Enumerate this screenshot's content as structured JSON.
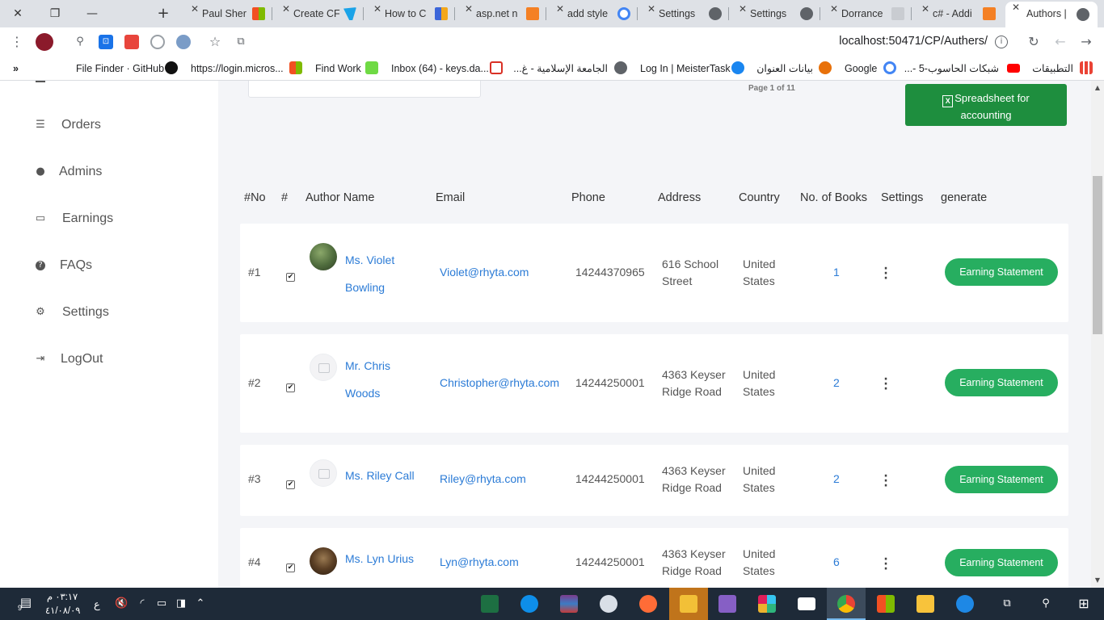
{
  "browser": {
    "tabs": [
      {
        "label": "Paul Sher",
        "favicon_color": "#f25022"
      },
      {
        "label": "Create CF",
        "favicon_color": "#1aa3e8"
      },
      {
        "label": "How to C",
        "favicon_color": "#3c66d9"
      },
      {
        "label": "asp.net n",
        "favicon_color": "#f48024"
      },
      {
        "label": "add style",
        "favicon_color": "#4285f4"
      },
      {
        "label": "Settings",
        "favicon_color": "#5f6368"
      },
      {
        "label": "Settings",
        "favicon_color": "#5f6368"
      },
      {
        "label": "Dorrance",
        "favicon_color": "#c9ccd1"
      },
      {
        "label": "c# - Addi",
        "favicon_color": "#f48024"
      },
      {
        "label": "Authors |",
        "favicon_color": "#5f6368",
        "active": true
      }
    ],
    "url": "localhost:50471/CP/Authers/",
    "bookmarks_left": "»",
    "bookmarks": [
      {
        "label": "File Finder · GitHub",
        "icon": "github-icon",
        "color": "#111"
      },
      {
        "label": "https://login.micros...",
        "icon": "microsoft-icon",
        "color": "#f25022"
      },
      {
        "label": "Find Work",
        "icon": "upwork-icon",
        "color": "#6fda44"
      },
      {
        "label": "Inbox (64) - keys.da...",
        "icon": "gmail-icon",
        "color": "#d93025"
      },
      {
        "label": "الجامعة الإسلامية - غ...",
        "icon": "globe-icon",
        "color": "#5f6368"
      },
      {
        "label": "Log In | MeisterTask",
        "icon": "meistertask-icon",
        "color": "#1a86f0"
      },
      {
        "label": "بيانات العنوان",
        "icon": "orange-site-icon",
        "color": "#e8710a"
      },
      {
        "label": "Google",
        "icon": "google-icon",
        "color": "#4285f4"
      },
      {
        "label": "شبكات الحاسوب-5 -...",
        "icon": "youtube-icon",
        "color": "#ff0000"
      },
      {
        "label": "التطبيقات",
        "icon": "apps-grid-icon",
        "color": "#ea4335"
      }
    ]
  },
  "sidebar": {
    "items": [
      {
        "label": "Orders",
        "icon": "list-icon"
      },
      {
        "label": "Admins",
        "icon": "user-icon"
      },
      {
        "label": "Earnings",
        "icon": "monitor-icon"
      },
      {
        "label": "FAQs",
        "icon": "question-icon"
      },
      {
        "label": "Settings",
        "icon": "cogs-icon"
      },
      {
        "label": "LogOut",
        "icon": "logout-icon"
      }
    ]
  },
  "main": {
    "page_info": "Page 1 of 11",
    "export_button": {
      "line1": "Spreadsheet for",
      "line2": "accounting"
    },
    "columns": [
      "#No",
      "#",
      "Author Name",
      "Email",
      "Phone",
      "Address",
      "Country",
      "No. of Books",
      "Settings",
      "generate"
    ],
    "rows": [
      {
        "no": "#1",
        "name1": "Ms. Violet",
        "name2": "Bowling",
        "email": "Violet@rhyta.com",
        "phone": "14244370965",
        "addr1": "616 School",
        "addr2": "Street",
        "country1": "United",
        "country2": "States",
        "books": "1",
        "action": "Earning Statement",
        "avatar": "photo"
      },
      {
        "no": "#2",
        "name1": "Mr. Chris",
        "name2": "Woods",
        "email": "Christopher@rhyta.com",
        "phone": "14244250001",
        "addr1": "4363 Keyser",
        "addr2": "Ridge Road",
        "country1": "United",
        "country2": "States",
        "books": "2",
        "action": "Earning Statement",
        "avatar": "placeholder"
      },
      {
        "no": "#3",
        "name1": "Ms. Riley Call",
        "name2": "",
        "email": "Riley@rhyta.com",
        "phone": "14244250001",
        "addr1": "4363 Keyser",
        "addr2": "Ridge Road",
        "country1": "United",
        "country2": "States",
        "books": "2",
        "action": "Earning Statement",
        "avatar": "placeholder"
      },
      {
        "no": "#4",
        "name1": "Ms. Lyn Urius",
        "name2": "",
        "email": "Lyn@rhyta.com",
        "phone": "14244250001",
        "addr1": "4363 Keyser",
        "addr2": "Ridge Road",
        "country1": "United",
        "country2": "States",
        "books": "6",
        "action": "Earning Statement",
        "avatar": "photo"
      }
    ]
  },
  "taskbar": {
    "time": "٠٣:١٧ م",
    "date": "٤١/٠٨/٠٩",
    "lang": "ع",
    "notification_count": "9"
  }
}
